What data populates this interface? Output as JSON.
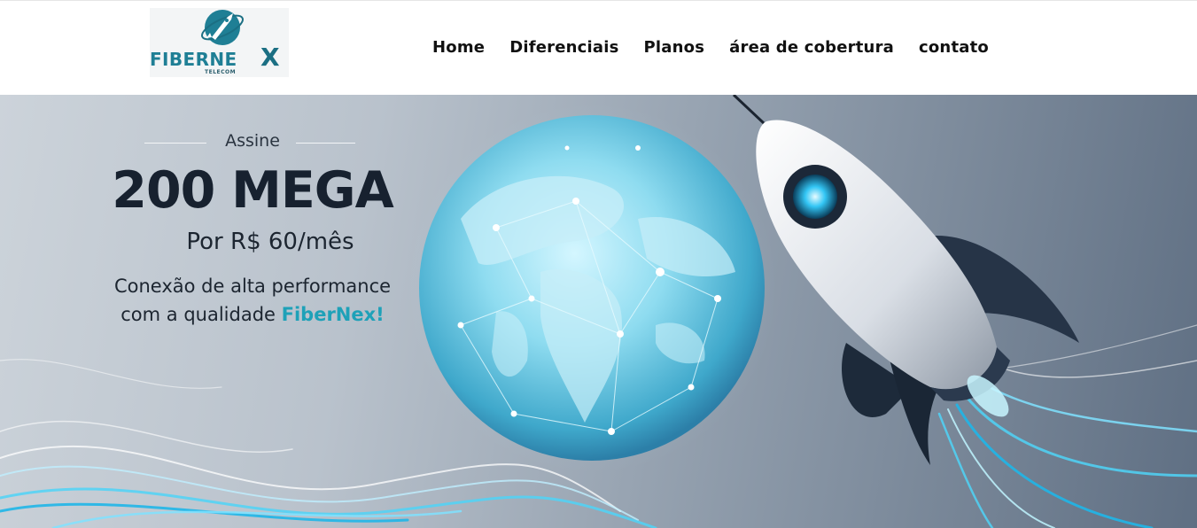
{
  "header": {
    "logo": {
      "wordmark": "FIBERNE",
      "wordmark_x": "X",
      "subtitle": "TELECOM",
      "icon": "rocket-globe-icon"
    },
    "nav": [
      {
        "label": "Home"
      },
      {
        "label": "Diferenciais"
      },
      {
        "label": "Planos"
      },
      {
        "label": "área de cobertura"
      },
      {
        "label": "contato"
      }
    ]
  },
  "hero": {
    "eyebrow": "Assine",
    "headline": "200 MEGA",
    "price": "Por R$ 60/mês",
    "description_line1": "Conexão de alta performance",
    "description_line2_prefix": "com a qualidade ",
    "description_line2_brand": "FiberNex!",
    "imagery": [
      "globe-network-illustration",
      "rocket-illustration",
      "light-fiber-streams"
    ]
  },
  "colors": {
    "brand_teal": "#1ea1b8",
    "logo_teal": "#1f7f95",
    "headline_dark": "#17212f",
    "nav_text": "#111111"
  }
}
